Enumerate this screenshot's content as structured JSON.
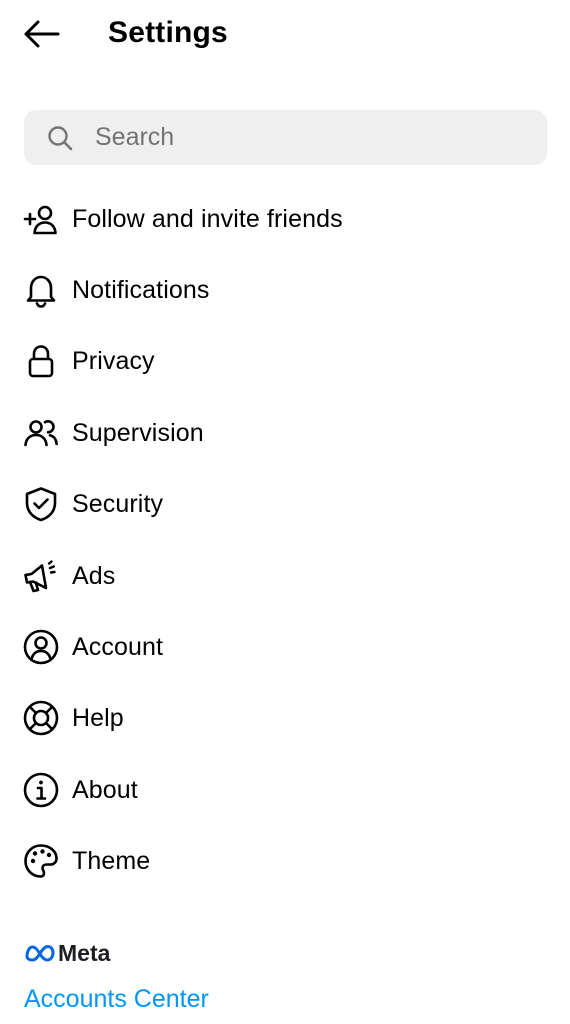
{
  "header": {
    "title": "Settings",
    "back_icon": "arrow-left-icon"
  },
  "search": {
    "placeholder": "Search",
    "value": "",
    "icon": "search-icon"
  },
  "menu": {
    "items": [
      {
        "label": "Follow and invite friends",
        "icon": "add-person-icon"
      },
      {
        "label": "Notifications",
        "icon": "bell-icon"
      },
      {
        "label": "Privacy",
        "icon": "lock-icon"
      },
      {
        "label": "Supervision",
        "icon": "people-icon"
      },
      {
        "label": "Security",
        "icon": "shield-check-icon"
      },
      {
        "label": "Ads",
        "icon": "megaphone-icon"
      },
      {
        "label": "Account",
        "icon": "account-circle-icon"
      },
      {
        "label": "Help",
        "icon": "lifebuoy-icon"
      },
      {
        "label": "About",
        "icon": "info-icon"
      },
      {
        "label": "Theme",
        "icon": "palette-icon"
      }
    ]
  },
  "meta": {
    "logo_text": "Meta",
    "accounts_center": "Accounts Center"
  },
  "colors": {
    "link": "#0095f6",
    "meta_blue": "#0668E1",
    "search_bg": "#efefef",
    "text": "#000000"
  }
}
